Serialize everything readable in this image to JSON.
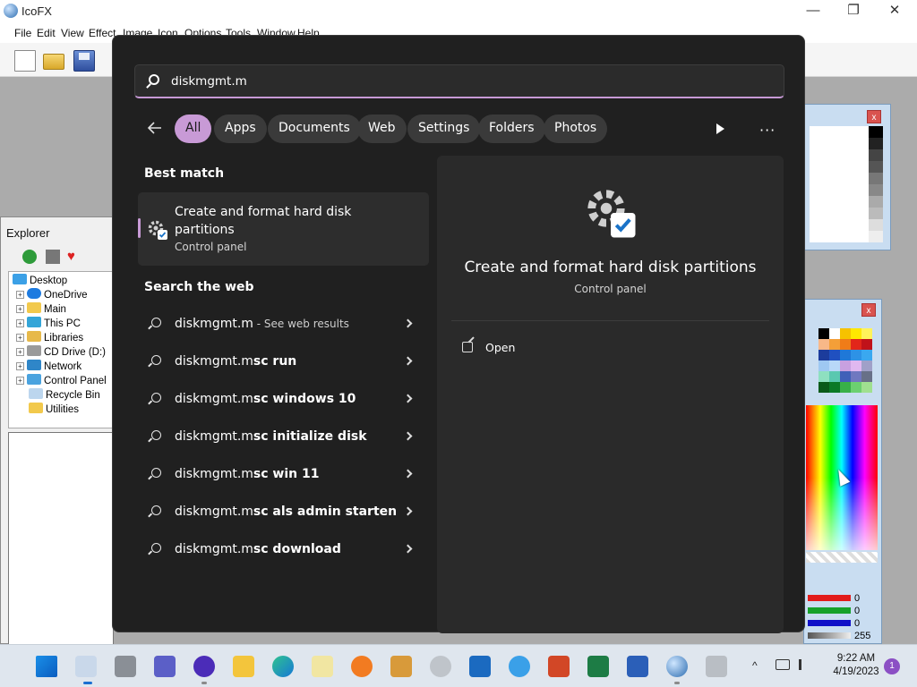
{
  "app": {
    "title": "IcoFX",
    "menu": [
      "File",
      "Edit",
      "View",
      "Effect",
      "Image",
      "Icon",
      "Options",
      "Tools",
      "Window",
      "Help"
    ],
    "window_controls": [
      "—",
      "❐",
      "✕"
    ]
  },
  "explorer": {
    "title": "Explorer",
    "tree": [
      "Desktop",
      "OneDrive",
      "Main",
      "This PC",
      "Libraries",
      "CD Drive (D:)",
      "Network",
      "Control Panel",
      "Recycle Bin",
      "Utilities"
    ]
  },
  "color_panel": {
    "close_glyph": "x",
    "rgb_values": [
      "0",
      "0",
      "0",
      "255"
    ]
  },
  "search": {
    "query": "diskmgmt.m",
    "filters": [
      "All",
      "Apps",
      "Documents",
      "Web",
      "Settings",
      "Folders",
      "Photos"
    ],
    "more_glyph": "···",
    "best_match_title": "Best match",
    "best_match": {
      "name": "Create and format hard disk partitions",
      "type": "Control panel"
    },
    "web_title": "Search the web",
    "web_results": [
      {
        "text": "diskmgmt.m",
        "hint": " - See web results"
      },
      {
        "prefix": "diskmgmt.m",
        "bold": "sc run"
      },
      {
        "prefix": "diskmgmt.m",
        "bold": "sc windows 10"
      },
      {
        "prefix": "diskmgmt.m",
        "bold": "sc initialize disk"
      },
      {
        "prefix": "diskmgmt.m",
        "bold": "sc win 11"
      },
      {
        "prefix": "diskmgmt.m",
        "bold": "sc als admin starten"
      },
      {
        "prefix": "diskmgmt.m",
        "bold": "sc download"
      }
    ],
    "preview": {
      "title": "Create and format hard disk partitions",
      "subtitle": "Control panel",
      "open_label": "Open"
    }
  },
  "taskbar": {
    "clock_time": "9:22 AM",
    "clock_date": "4/19/2023",
    "notification_count": "1",
    "tray_chevron": "^"
  },
  "colors": {
    "accent": "#c89ad6",
    "panel_bg": "#202020",
    "preview_bg": "#2a2a2a"
  }
}
